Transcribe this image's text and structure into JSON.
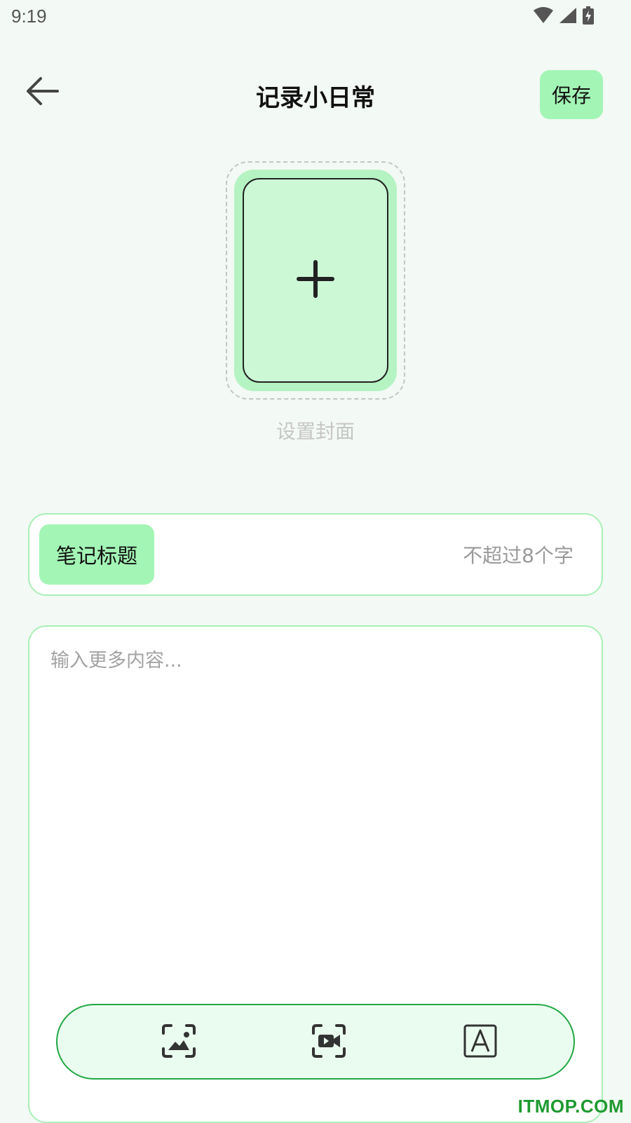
{
  "status_bar": {
    "time": "9:19"
  },
  "header": {
    "title": "记录小日常",
    "save_label": "保存"
  },
  "cover": {
    "label": "设置封面"
  },
  "title_field": {
    "label": "笔记标题",
    "placeholder": "不超过8个字",
    "value": ""
  },
  "content_field": {
    "placeholder": "输入更多内容...",
    "value": ""
  },
  "toolbar": {
    "icons": [
      "image-icon",
      "video-icon",
      "text-icon"
    ]
  },
  "watermark": {
    "text": "ITMOP.COM"
  },
  "colors": {
    "accent": "#a3f5b5",
    "border": "#a8f0b8",
    "toolbar_border": "#22a845",
    "background": "#f3f9f4"
  }
}
